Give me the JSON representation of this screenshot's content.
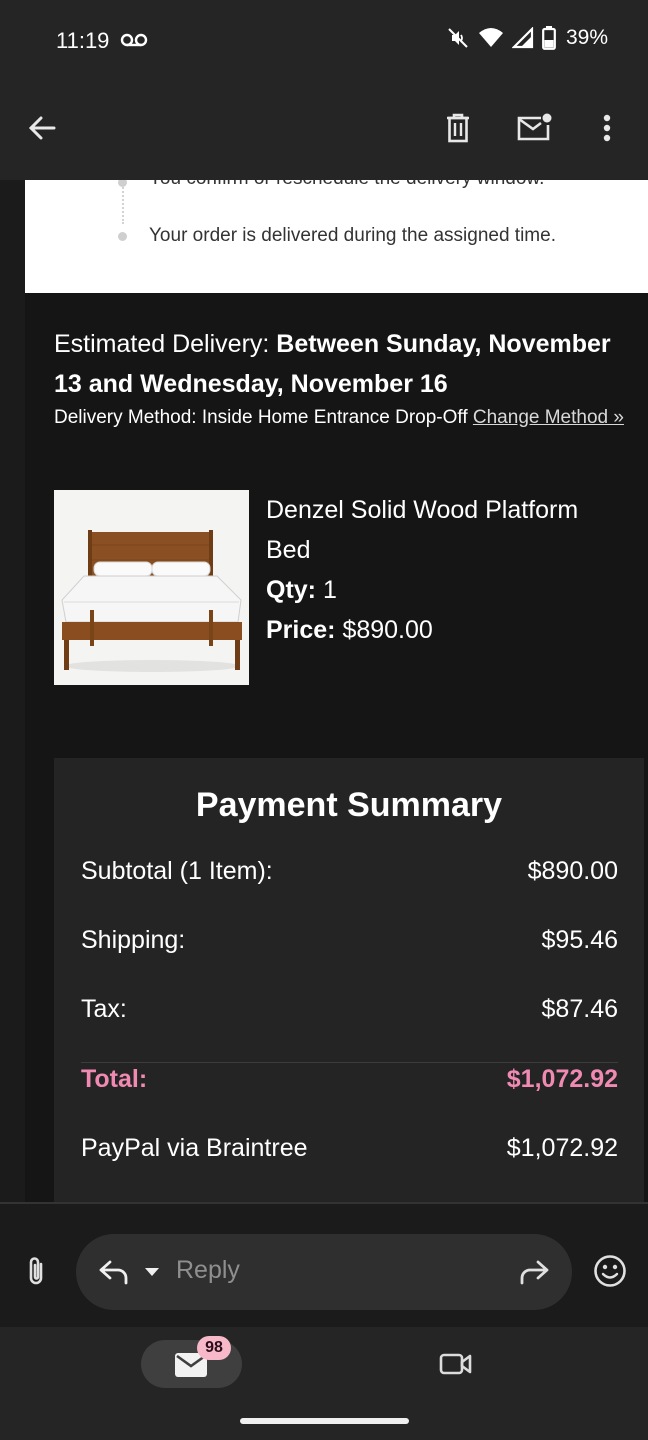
{
  "status_bar": {
    "time": "11:19",
    "battery": "39%",
    "icons": [
      "voicemail-icon",
      "mute-icon",
      "wifi-icon",
      "signal-icon",
      "battery-icon"
    ]
  },
  "app_bar": {
    "icons": [
      "back-arrow-icon",
      "delete-icon",
      "mark-unread-icon",
      "more-vert-icon"
    ]
  },
  "email": {
    "steps": [
      "You confirm or reschedule the delivery window.",
      "Your order is delivered during the assigned time."
    ],
    "delivery": {
      "label": "Estimated Delivery: ",
      "value": "Between Sunday, November 13 and Wednesday, November 16",
      "method_label": "Delivery Method: Inside Home Entrance Drop-Off ",
      "change_link": "Change Method »"
    },
    "product": {
      "name": "Denzel Solid Wood Platform Bed",
      "qty_label": "Qty:",
      "qty": "1",
      "price_label": "Price:",
      "price": "$890.00"
    },
    "payment": {
      "title": "Payment Summary",
      "rows": [
        {
          "label": "Subtotal (1 Item):",
          "value": "$890.00"
        },
        {
          "label": "Shipping:",
          "value": "$95.46"
        },
        {
          "label": "Tax:",
          "value": "$87.46"
        },
        {
          "label": "Total:",
          "value": "$1,072.92"
        },
        {
          "label": "PayPal via Braintree",
          "value": "$1,072.92"
        }
      ]
    }
  },
  "reply_bar": {
    "placeholder": "Reply"
  },
  "bottom_nav": {
    "mail_badge": "98"
  },
  "colors": {
    "total_accent": "#f08ab2",
    "badge_bg": "#f7b9ca",
    "surface": "#252525",
    "background": "#151515"
  }
}
